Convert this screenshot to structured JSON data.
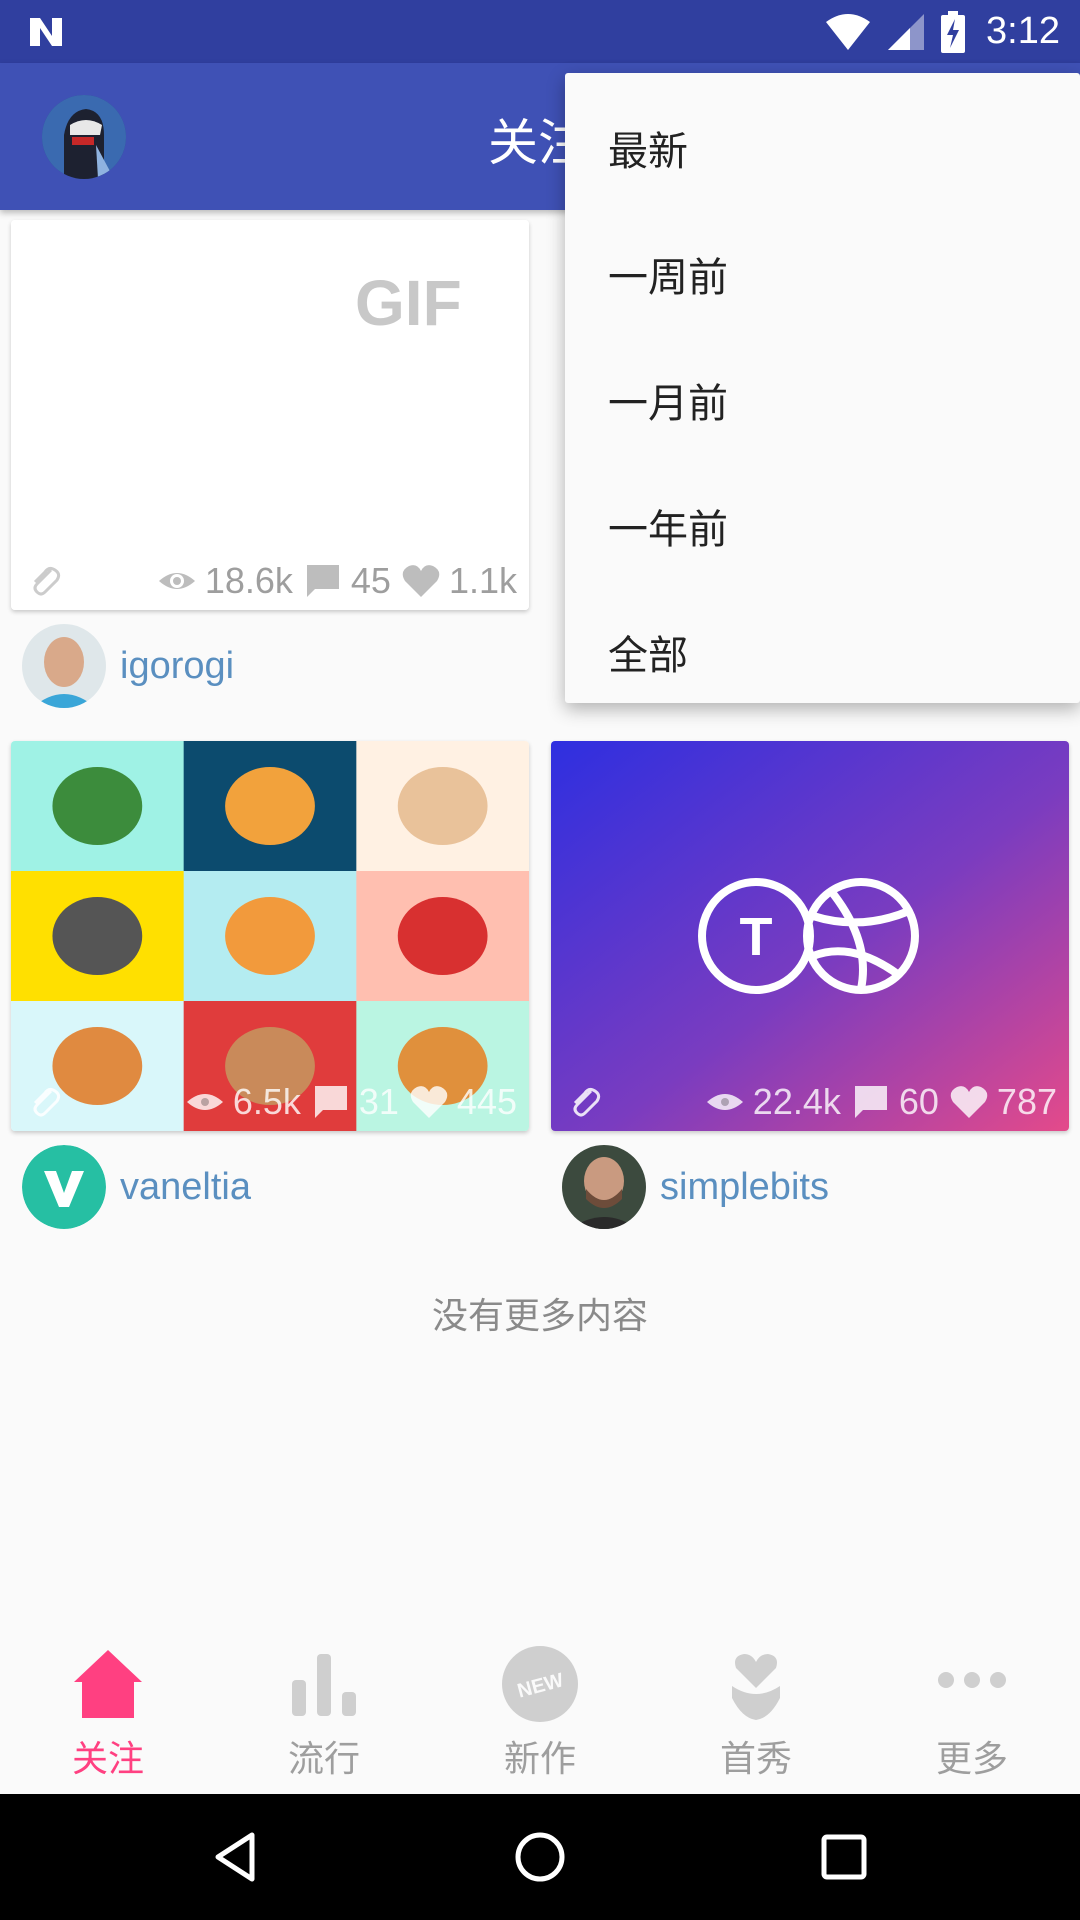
{
  "status_bar": {
    "time": "3:12"
  },
  "app_bar": {
    "title": "关注"
  },
  "cards": [
    {
      "badge": "GIF",
      "views": "18.6k",
      "comments": "45",
      "likes": "1.1k",
      "author": "igorogi"
    },
    {
      "views": "6.5k",
      "comments": "31",
      "likes": "445",
      "author": "vaneltia"
    },
    {
      "views": "22.4k",
      "comments": "60",
      "likes": "787",
      "author": "simplebits"
    }
  ],
  "tile_colors": [
    "#9ff2e5",
    "#0c4b6e",
    "#fff1e3",
    "#ffe000",
    "#b4ecf1",
    "#ffbfb0",
    "#d9f7fa",
    "#e03c3c",
    "#baf5e2"
  ],
  "no_more_text": "没有更多内容",
  "menu": {
    "items": [
      "最新",
      "一周前",
      "一月前",
      "一年前",
      "全部"
    ]
  },
  "bottom_nav": {
    "items": [
      {
        "label": "关注",
        "icon": "home-icon",
        "active": true
      },
      {
        "label": "流行",
        "icon": "bar-chart-icon"
      },
      {
        "label": "新作",
        "icon": "new-badge-icon"
      },
      {
        "label": "首秀",
        "icon": "debut-heart-icon"
      },
      {
        "label": "更多",
        "icon": "more-dots-icon"
      }
    ]
  },
  "colors": {
    "primary": "#3f51b5",
    "primary_dark": "#303f9f",
    "accent": "#ff4081",
    "link": "#5a8fc0"
  }
}
